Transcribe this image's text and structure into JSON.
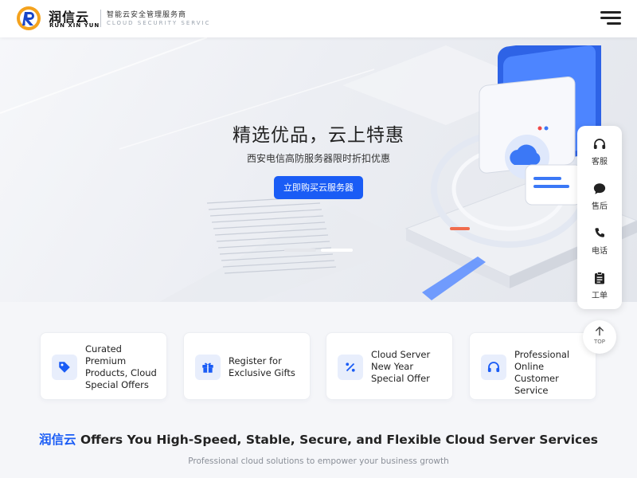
{
  "header": {
    "logo_cn": "润信云",
    "logo_en": "RUN XIN YUN",
    "slogan_cn": "智能云安全管理服务商",
    "slogan_en": "CLOUD SECURITY SERVICE",
    "menu_icon": "hamburger-menu-icon"
  },
  "hero": {
    "title": "精选优品，云上特惠",
    "subtitle": "西安电信高防服务器限时折扣优惠",
    "cta_label": "立即购买云服务器",
    "slide_count": 2,
    "active_slide": 2
  },
  "float_bar": {
    "items": [
      {
        "label": "客服",
        "icon": "headset-icon"
      },
      {
        "label": "售后",
        "icon": "chat-bubble-icon"
      },
      {
        "label": "电话",
        "icon": "phone-icon"
      },
      {
        "label": "工单",
        "icon": "clipboard-icon"
      }
    ],
    "top_label": "TOP"
  },
  "features": [
    {
      "text": "Curated Premium Products, Cloud Special Offers",
      "icon": "tag-icon"
    },
    {
      "text": "Register for Exclusive Gifts",
      "icon": "gift-icon"
    },
    {
      "text": "Cloud Server New Year Special Offer",
      "icon": "percent-icon"
    },
    {
      "text": "Professional Online Customer Service",
      "icon": "headset-icon"
    }
  ],
  "section": {
    "brand": "润信云",
    "title_rest": " Offers You High-Speed, Stable, Secure, and Flexible Cloud Server Services",
    "subtitle": "Professional cloud solutions to empower your business growth"
  },
  "colors": {
    "accent": "#1a5cf5",
    "icon_bg": "#e8eefc",
    "logo_orange": "#f4a21d"
  }
}
